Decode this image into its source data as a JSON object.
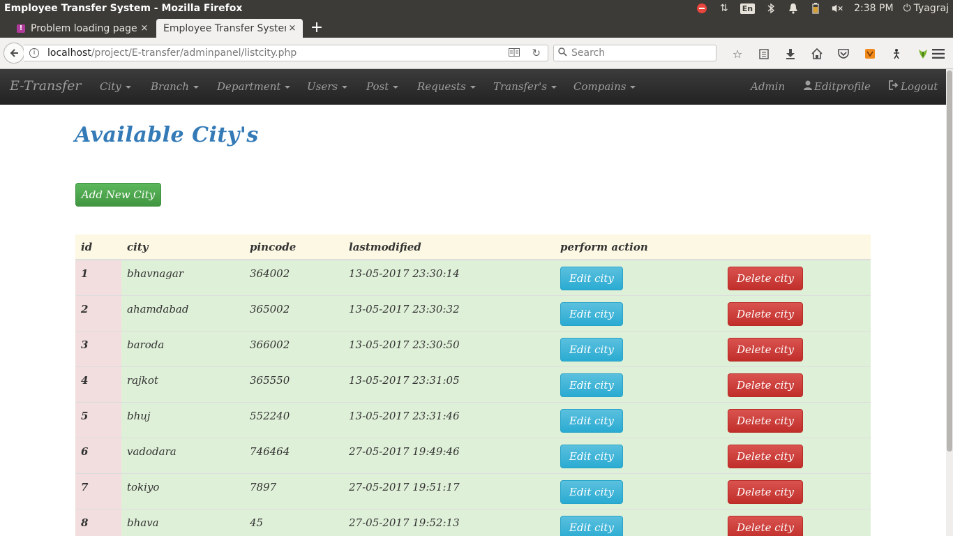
{
  "os": {
    "window_title": "Employee Transfer System - Mozilla Firefox",
    "lang": "En",
    "time": "2:38 PM",
    "user": "Tyagraj"
  },
  "tabs": [
    {
      "label": "Problem loading page",
      "close": "×"
    },
    {
      "label": "Employee Transfer System",
      "close": "×"
    }
  ],
  "new_tab": "+",
  "browser": {
    "url_host": "localhost",
    "url_path": "/project/E-transfer/adminpanel/listcity.php",
    "search_placeholder": "Search"
  },
  "navbar": {
    "brand": "E-Transfer",
    "menus": [
      "City",
      "Branch",
      "Department",
      "Users",
      "Post",
      "Requests",
      "Transfer's",
      "Compains"
    ],
    "admin": "Admin",
    "editprofile": "Editprofile",
    "logout": "Logout"
  },
  "page": {
    "title": "Available City's",
    "add_button": "Add New City"
  },
  "table": {
    "headers": {
      "id": "id",
      "city": "city",
      "pincode": "pincode",
      "lastmodified": "lastmodified",
      "action": "perform action"
    },
    "edit_label": "Edit city",
    "delete_label": "Delete city",
    "rows": [
      {
        "id": "1",
        "city": "bhavnagar",
        "pincode": "364002",
        "lastmodified": "13-05-2017 23:30:14"
      },
      {
        "id": "2",
        "city": "ahamdabad",
        "pincode": "365002",
        "lastmodified": "13-05-2017 23:30:32"
      },
      {
        "id": "3",
        "city": "baroda",
        "pincode": "366002",
        "lastmodified": "13-05-2017 23:30:50"
      },
      {
        "id": "4",
        "city": "rajkot",
        "pincode": "365550",
        "lastmodified": "13-05-2017 23:31:05"
      },
      {
        "id": "5",
        "city": "bhuj",
        "pincode": "552240",
        "lastmodified": "13-05-2017 23:31:46"
      },
      {
        "id": "6",
        "city": "vadodara",
        "pincode": "746464",
        "lastmodified": "27-05-2017 19:49:46"
      },
      {
        "id": "7",
        "city": "tokiyo",
        "pincode": "7897",
        "lastmodified": "27-05-2017 19:51:17"
      },
      {
        "id": "8",
        "city": "bhava",
        "pincode": "45",
        "lastmodified": "27-05-2017 19:52:13"
      }
    ]
  },
  "colors": {
    "brand_blue": "#337ab7",
    "success": "#5cb85c",
    "info": "#5bc0de",
    "danger": "#d9534f",
    "row_success": "#dff0d8",
    "row_danger": "#f2dede",
    "header_warning": "#fcf8e3"
  }
}
